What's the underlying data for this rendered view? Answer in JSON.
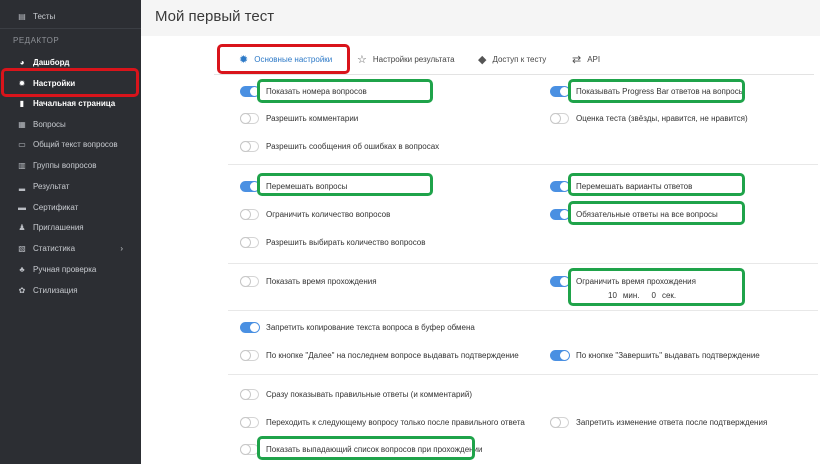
{
  "sidebar": {
    "top_item": {
      "label": "Тесты",
      "icon": "file-icon"
    },
    "section_header": "РЕДАКТОР",
    "items": [
      {
        "label": "Дашборд",
        "icon": "dashboard-icon",
        "bold": true
      },
      {
        "label": "Настройки",
        "icon": "gear-icon",
        "bold": true
      },
      {
        "label": "Начальная страница",
        "icon": "page-icon",
        "bold": true
      },
      {
        "label": "Вопросы",
        "icon": "list-icon",
        "bold": false
      },
      {
        "label": "Общий текст вопросов",
        "icon": "file-text-icon",
        "bold": false
      },
      {
        "label": "Группы вопросов",
        "icon": "layers-icon",
        "bold": false
      },
      {
        "label": "Результат",
        "icon": "bar-chart-icon",
        "bold": false
      },
      {
        "label": "Сертификат",
        "icon": "certificate-icon",
        "bold": false
      },
      {
        "label": "Приглашения",
        "icon": "invite-icon",
        "bold": false
      },
      {
        "label": "Статистика",
        "icon": "stats-icon",
        "bold": false
      },
      {
        "label": "Ручная проверка",
        "icon": "users-icon",
        "bold": false
      },
      {
        "label": "Стилизация",
        "icon": "palette-icon",
        "bold": false
      }
    ],
    "stats_arrow": "›"
  },
  "page_title": "Мой первый тест",
  "tabs": [
    {
      "label": "Основные настройки",
      "icon": "gear-icon",
      "active": true
    },
    {
      "label": "Настройки результата",
      "icon": "star-icon",
      "active": false
    },
    {
      "label": "Доступ к тесту",
      "icon": "shield-icon",
      "active": false
    },
    {
      "label": "API",
      "icon": "swap-icon",
      "active": false
    }
  ],
  "settings": {
    "show_numbers": {
      "label": "Показать номера вопросов",
      "on": true
    },
    "show_progress": {
      "label": "Показывать Progress Bar ответов на вопросы",
      "on": true
    },
    "allow_comments": {
      "label": "Разрешить комментарии",
      "on": false
    },
    "rating": {
      "label": "Оценка теста (звёзды, нравится, не нравится)",
      "on": false
    },
    "error_reports": {
      "label": "Разрешить сообщения об ошибках в вопросах",
      "on": false
    },
    "shuffle_questions": {
      "label": "Перемешать вопросы",
      "on": true
    },
    "shuffle_answers": {
      "label": "Перемешать варианты ответов",
      "on": true
    },
    "limit_questions": {
      "label": "Ограничить количество вопросов",
      "on": false
    },
    "required_answers": {
      "label": "Обязательные ответы на все вопросы",
      "on": true
    },
    "choose_count": {
      "label": "Разрешить выбирать количество вопросов",
      "on": false
    },
    "show_time": {
      "label": "Показать время прохождения",
      "on": false
    },
    "limit_time": {
      "label": "Ограничить время прохождения",
      "on": true
    },
    "time_limit": {
      "minutes": "10",
      "min_label": "мин.",
      "seconds": "0",
      "sec_label": "сек."
    },
    "no_copy": {
      "label": "Запретить копирование текста вопроса в буфер обмена",
      "on": true
    },
    "confirm_next": {
      "label": "По кнопке \"Далее\" на последнем вопросе выдавать подтверждение",
      "on": false
    },
    "confirm_finish": {
      "label": "По кнопке \"Завершить\" выдавать подтверждение",
      "on": true
    },
    "show_correct": {
      "label": "Сразу показывать правильные ответы (и комментарий)",
      "on": false
    },
    "next_after_correct": {
      "label": "Переходить к следующему вопросу только после правильного ответа",
      "on": false
    },
    "no_change_after_confirm": {
      "label": "Запретить изменение ответа после подтверждения",
      "on": false
    },
    "dropdown_list": {
      "label": "Показать выпадающий список вопросов при прохождении",
      "on": false
    }
  },
  "colors": {
    "accent": "#4a90e2",
    "highlight_red": "#d9141b",
    "highlight_green": "#1fa34a",
    "sidebar_bg": "#2c2e33"
  }
}
